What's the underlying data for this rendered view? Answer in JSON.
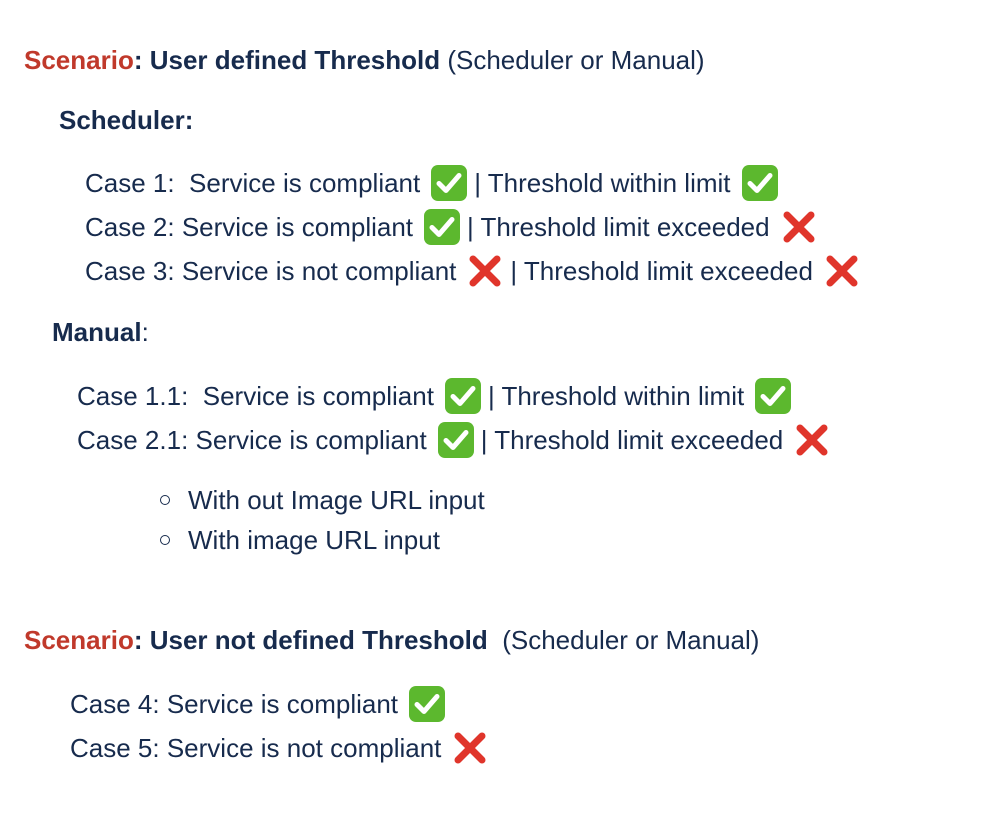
{
  "scenario1": {
    "prefix": "Scenario",
    "colon": ":",
    "title": " User defined Threshold",
    "suffix": " (Scheduler or Manual)"
  },
  "scheduler": {
    "heading": "Scheduler:",
    "cases": [
      {
        "text": "Case 1:  Service is compliant",
        "status1": "check",
        "mid": "| Threshold within limit",
        "status2": "check"
      },
      {
        "text": "Case 2: Service is compliant",
        "status1": "check",
        "mid": "| Threshold limit exceeded",
        "status2": "cross"
      },
      {
        "text": "Case 3: Service is not compliant",
        "status1": "cross",
        "mid": "| Threshold limit exceeded",
        "status2": "cross"
      }
    ]
  },
  "manual": {
    "heading": "Manual",
    "colon": ":",
    "cases": [
      {
        "text": "Case 1.1:  Service is compliant",
        "status1": "check",
        "mid": "| Threshold within limit",
        "status2": "check"
      },
      {
        "text": "Case 2.1: Service is compliant",
        "status1": "check",
        "mid": "| Threshold limit exceeded",
        "status2": "cross"
      }
    ],
    "subitems": [
      "With out Image URL input",
      "With image URL input"
    ]
  },
  "scenario2": {
    "prefix": "Scenario",
    "colon": ":",
    "title": " User not defined Threshold",
    "suffix": "  (Scheduler or Manual)",
    "cases": [
      {
        "text": "Case 4: Service is compliant",
        "status": "check"
      },
      {
        "text": "Case 5: Service is not compliant",
        "status": "cross"
      }
    ]
  },
  "icons": {
    "check": "white-check-mark-icon",
    "cross": "red-cross-mark-icon"
  },
  "colors": {
    "text": "#172b4d",
    "scenario": "#c0392b",
    "check_bg": "#5cb82e",
    "cross": "#e0352b"
  }
}
